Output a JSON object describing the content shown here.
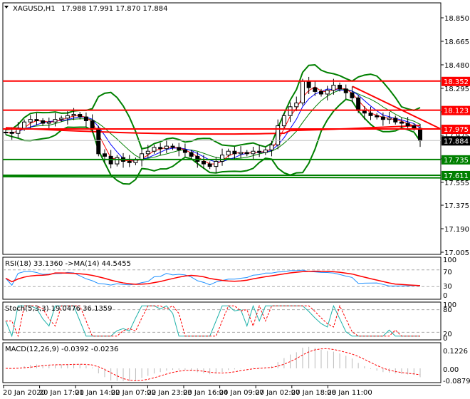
{
  "header": {
    "symbol": "XAGUSD,H1",
    "ohlc": "17.988 17.991 17.870 17.884"
  },
  "price_axis": {
    "ticks": [
      "18.850",
      "18.665",
      "18.480",
      "18.295",
      "18.110",
      "17.925",
      "17.740",
      "17.555",
      "17.375",
      "17.190",
      "17.005"
    ],
    "range": [
      17.005,
      18.85
    ]
  },
  "levels": [
    {
      "label": "18.352",
      "value": 18.352,
      "color": "#ff0000"
    },
    {
      "label": "18.123",
      "value": 18.123,
      "color": "#ff0000"
    },
    {
      "label": "17.975",
      "value": 17.975,
      "color": "#ff0000"
    },
    {
      "label": "17.735",
      "value": 17.735,
      "color": "#008000"
    },
    {
      "label": "17.611",
      "value": 17.611,
      "color": "#008000"
    }
  ],
  "current_price": {
    "label": "17.884",
    "value": 17.884
  },
  "closes": [
    17.95,
    17.94,
    17.98,
    18.03,
    18.05,
    18.04,
    18.02,
    18.03,
    18.05,
    18.06,
    18.08,
    18.09,
    18.07,
    18.04,
    17.98,
    17.78,
    17.76,
    17.7,
    17.75,
    17.72,
    17.71,
    17.73,
    17.78,
    17.8,
    17.83,
    17.82,
    17.84,
    17.83,
    17.81,
    17.79,
    17.76,
    17.72,
    17.7,
    17.68,
    17.72,
    17.77,
    17.8,
    17.78,
    17.79,
    17.78,
    17.8,
    17.79,
    17.81,
    17.85,
    18.0,
    18.08,
    18.15,
    18.18,
    18.35,
    18.3,
    18.27,
    18.25,
    18.28,
    18.32,
    18.29,
    18.26,
    18.22,
    18.12,
    18.1,
    18.08,
    18.07,
    18.05,
    18.06,
    18.03,
    18.02,
    18.0,
    17.98,
    17.884
  ],
  "rsi": {
    "label": "RSI(18) 33.1360  ->MA(14) 44.5455",
    "ticks": [
      "100",
      "70",
      "30",
      "0"
    ]
  },
  "stoch": {
    "label": "Stoch(5,3,3) 19.0476 36.1359",
    "ticks": [
      "100",
      "80",
      "20",
      "0"
    ]
  },
  "macd": {
    "label": "MACD(12,26,9) -0.0392 -0.0236",
    "ticks": [
      "0.1226",
      "0.00",
      "-0.0879"
    ]
  },
  "time_axis": [
    "20 Jan 2020",
    "20 Jan 17:00",
    "21 Jan 14:00",
    "22 Jan 07:00",
    "22 Jan 23:00",
    "23 Jan 16:00",
    "24 Jan 09:00",
    "27 Jan 02:00",
    "27 Jan 18:00",
    "28 Jan 11:00"
  ]
}
